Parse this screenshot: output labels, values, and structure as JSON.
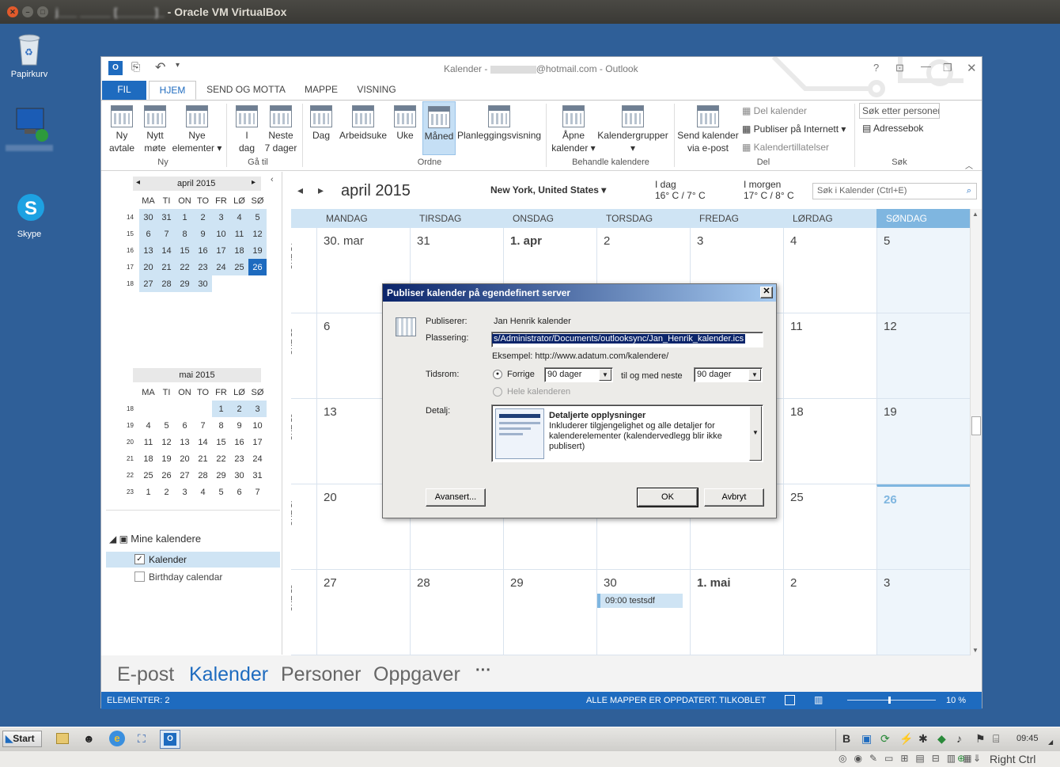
{
  "host": {
    "title": "Oracle VM VirtualBox",
    "title_masked": "j___ _____ [______]_",
    "right_ctrl": "Right Ctrl"
  },
  "desktop": {
    "icons": [
      {
        "label": "Papirkurv"
      },
      {
        "label": ""
      },
      {
        "label": "Skype"
      }
    ]
  },
  "outlook": {
    "title_prefix": "Kalender - ",
    "title_suffix": "@hotmail.com - Outlook",
    "tabs": [
      "FIL",
      "HJEM",
      "SEND OG MOTTA",
      "MAPPE",
      "VISNING"
    ],
    "ribbon": {
      "ny_avtale": "Ny\navtale",
      "nytt_mote": "Nytt\nmøte",
      "nye_elementer": "Nye\nelementer ▾",
      "i_dag": "I\ndag",
      "neste_7": "Neste\n7 dager",
      "dag": "Dag",
      "arbeidsuke": "Arbeidsuke",
      "uke": "Uke",
      "maned": "Måned",
      "planlegging": "Planleggingsvisning",
      "apne_kalender": "Åpne\nkalender ▾",
      "kalendergrupper": "Kalendergrupper\n▾",
      "send_kalender": "Send kalender\nvia e-post",
      "del_kalender": "Del kalender",
      "publiser": "Publiser på Internett ▾",
      "tillatelser": "Kalendertillatelser",
      "sok_personer": "Søk etter personer",
      "adressebok": "Adressebok",
      "groups": {
        "ny": "Ny",
        "ga_til": "Gå til",
        "ordne": "Ordne",
        "behandle": "Behandle kalendere",
        "del": "Del",
        "sok": "Søk"
      }
    },
    "mini1": {
      "title": "april 2015",
      "days": [
        "MA",
        "TI",
        "ON",
        "TO",
        "FR",
        "LØ",
        "SØ"
      ],
      "weeks": [
        [
          "14",
          "30",
          "31",
          "1",
          "2",
          "3",
          "4",
          "5"
        ],
        [
          "15",
          "6",
          "7",
          "8",
          "9",
          "10",
          "11",
          "12"
        ],
        [
          "16",
          "13",
          "14",
          "15",
          "16",
          "17",
          "18",
          "19"
        ],
        [
          "17",
          "20",
          "21",
          "22",
          "23",
          "24",
          "25",
          "26"
        ],
        [
          "18",
          "27",
          "28",
          "29",
          "30",
          "",
          "",
          ""
        ]
      ]
    },
    "mini2": {
      "title": "mai 2015",
      "days": [
        "MA",
        "TI",
        "ON",
        "TO",
        "FR",
        "LØ",
        "SØ"
      ],
      "weeks": [
        [
          "18",
          "",
          "",
          "",
          "",
          "1",
          "2",
          "3"
        ],
        [
          "19",
          "4",
          "5",
          "6",
          "7",
          "8",
          "9",
          "10"
        ],
        [
          "20",
          "11",
          "12",
          "13",
          "14",
          "15",
          "16",
          "17"
        ],
        [
          "21",
          "18",
          "19",
          "20",
          "21",
          "22",
          "23",
          "24"
        ],
        [
          "22",
          "25",
          "26",
          "27",
          "28",
          "29",
          "30",
          "31"
        ],
        [
          "23",
          "1",
          "2",
          "3",
          "4",
          "5",
          "6",
          "7"
        ]
      ]
    },
    "my_calendars": "Mine kalendere",
    "cal1": "Kalender",
    "cal2": "Birthday calendar",
    "header": {
      "month": "april 2015",
      "location": "New York, United States",
      "today_label": "I dag",
      "today_temp": "16° C / 7° C",
      "tomorrow_label": "I morgen",
      "tomorrow_temp": "17° C / 8° C",
      "search_placeholder": "Søk i Kalender (Ctrl+E)"
    },
    "dayheads": [
      "MANDAG",
      "TIRSDAG",
      "ONSDAG",
      "TORSDAG",
      "FREDAG",
      "LØRDAG",
      "SØNDAG"
    ],
    "weeks": [
      {
        "label": "UKE 14",
        "days": [
          "30. mar",
          "31",
          "1. apr",
          "2",
          "3",
          "4",
          "5"
        ]
      },
      {
        "label": "UKE 15",
        "days": [
          "6",
          "",
          "",
          "",
          "",
          "11",
          "12"
        ]
      },
      {
        "label": "UKE 16",
        "days": [
          "13",
          "",
          "",
          "",
          "",
          "18",
          "19"
        ]
      },
      {
        "label": "UKE 17",
        "days": [
          "20",
          "",
          "",
          "",
          "",
          "25",
          "26"
        ]
      },
      {
        "label": "UKE 18",
        "days": [
          "27",
          "28",
          "29",
          "30",
          "1. mai",
          "2",
          "3"
        ]
      }
    ],
    "event": "09:00 testsdf",
    "nav": {
      "epost": "E-post",
      "kalender": "Kalender",
      "personer": "Personer",
      "oppgaver": "Oppgaver",
      "more": "···"
    },
    "status": {
      "elements": "ELEMENTER: 2",
      "updated": "ALLE MAPPER ER OPPDATERT.",
      "connected": "TILKOBLET",
      "zoom": "10 %"
    }
  },
  "dialog": {
    "title": "Publiser kalender på egendefinert server",
    "publiserer_label": "Publiserer:",
    "publiserer": "Jan Henrik kalender",
    "plassering_label": "Plassering:",
    "plassering": "s/Administrator/Documents/outlooksync/Jan_Henrik_kalender.ics",
    "eksempel": "Eksempel: http://www.adatum.com/kalendere/",
    "tidsrom_label": "Tidsrom:",
    "forrige": "Forrige",
    "forrige_val": "90 dager",
    "til_neste": "til og med neste",
    "neste_val": "90 dager",
    "hele": "Hele kalenderen",
    "detalj_label": "Detalj:",
    "detalj_title": "Detaljerte opplysninger",
    "detalj_text": "Inkluderer tilgjengelighet og alle detaljer for kalenderelementer (kalendervedlegg blir ikke publisert)",
    "avansert": "Avansert...",
    "ok": "OK",
    "avbryt": "Avbryt"
  },
  "taskbar": {
    "start": "Start",
    "time": "09:45"
  }
}
